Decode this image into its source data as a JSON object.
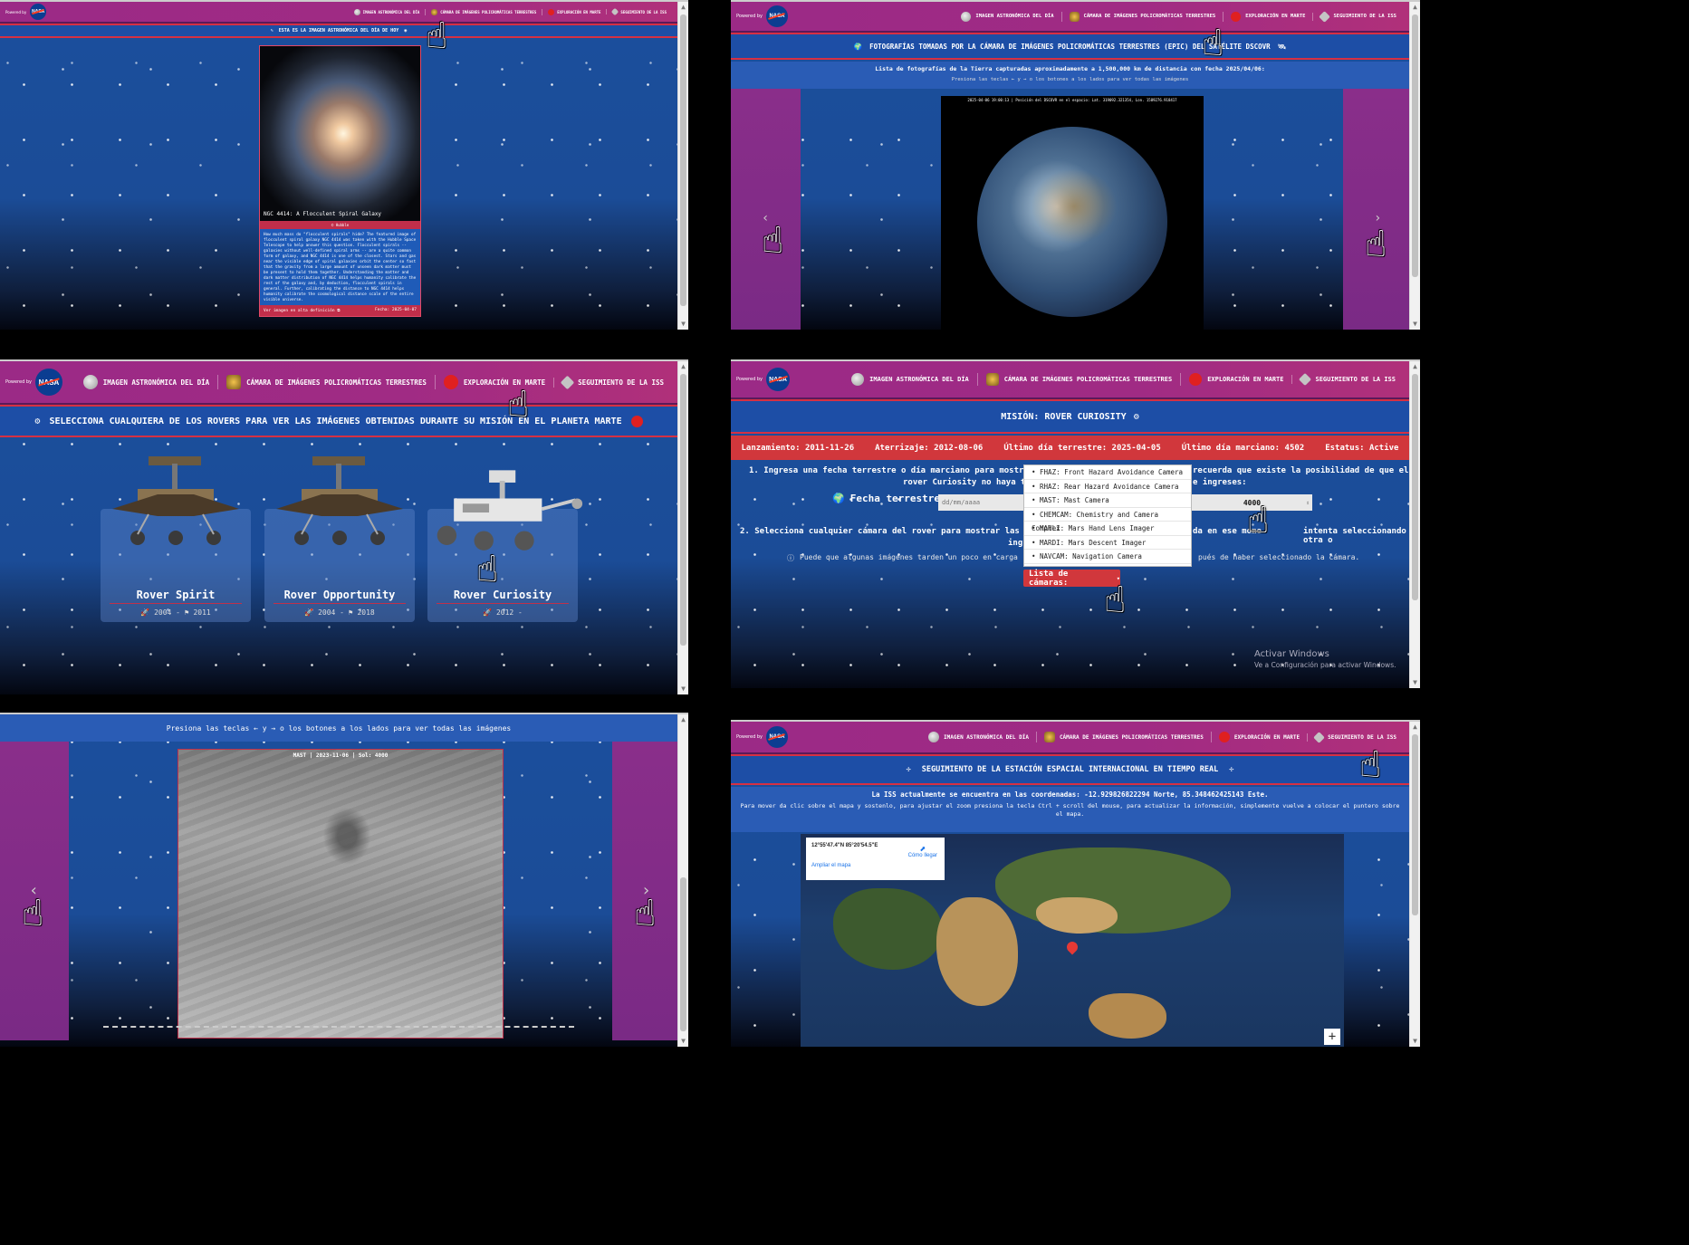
{
  "nav": {
    "powered_by": "Powered by",
    "logo": "NASA",
    "items": [
      "Imagen astronómica del día",
      "Cámara de imágenes policromáticas terrestres",
      "Exploración en Marte",
      "Seguimiento de la ISS"
    ]
  },
  "apod": {
    "banner": "Esta es la imagen astronómica del día de hoy",
    "image_title": "NGC 4414: A Flocculent Spiral Galaxy",
    "credit": "Hubble",
    "description": "How much mass do \"flocculent spirals\" hide? The featured image of flocculent spiral galaxy NGC 4414 was taken with the Hubble Space Telescope to help answer this question. Flocculent spirals -- galaxies without well-defined spiral arms -- are a quite common form of galaxy, and NGC 4414 is one of the closest. Stars and gas near the visible edge of spiral galaxies orbit the center so fast that the gravity from a large amount of unseen dark matter must be present to hold them together. Understanding the matter and dark matter distribution of NGC 4414 helps humanity calibrate the rest of the galaxy and, by deduction, flocculent spirals in general. Further, calibrating the distance to NGC 4414 helps humanity calibrate the cosmological distance scale of the entire visible universe.",
    "hd_link": "Ver imagen en alta definición",
    "date": "Fecha: 2025-04-07"
  },
  "epic": {
    "banner": "Fotografías tomadas por la cámara de imágenes policromáticas terrestres (EPIC) del satélite DSCOVR",
    "subtitle": "Lista de fotografías de la Tierra capturadas aproximadamente a 1,500,000 km de distancia con fecha 2025/04/06:",
    "hint": "Presiona las teclas ← y → o los botones a los lados para ver todas las imágenes",
    "caption": "2025-04-06 19:00:13 | Posición del DSCOVR en el espacio: Lat. 319092.321354, Lon. 1589276.918417"
  },
  "mars_select": {
    "banner": "Selecciona cualquiera de los rovers para ver las imágenes obtenidas durante su misión en el planeta Marte",
    "rovers": [
      {
        "name": "Rover Spirit",
        "start": "2004",
        "end": "2011"
      },
      {
        "name": "Rover Opportunity",
        "start": "2004",
        "end": "2018"
      },
      {
        "name": "Rover Curiosity",
        "start": "2012",
        "end": ""
      }
    ]
  },
  "mission": {
    "banner": "Misión: Rover Curiosity",
    "launch": "Lanzamiento: 2011-11-26",
    "landing": "Aterrizaje: 2012-08-06",
    "last_earth": "Último día terrestre: 2025-04-05",
    "last_sol": "Último día marciano: 4502",
    "status": "Estatus: Active",
    "step1_a": "1. Ingresa una fecha terrestre o día marciano para mostrar la",
    "step1_b": "recuerda que existe la posibilidad de que el",
    "step1_c": "rover Curiosity no haya tom",
    "step1_d": "e ingreses:",
    "earth_date_label": "Fecha terrestre:",
    "earth_date_placeholder": "dd/mm/aaaa",
    "sol_value": "4000",
    "step2_a": "2. Selecciona cualquier cámara del rover para mostrar las imág",
    "step2_b": "da en ese mome",
    "step2_c": "intenta seleccionando otra o",
    "step2_d": "ing",
    "note_a": "Puede que algunas imágenes tarden un poco en carga",
    "note_b": "pués de haber seleccionado la cámara.",
    "cameras": [
      "FHAZ: Front Hazard Avoidance Camera",
      "RHAZ: Rear Hazard Avoidance Camera",
      "MAST: Mast Camera",
      "CHEMCAM: Chemistry and Camera Complex",
      "MAHLI: Mars Hand Lens Imager",
      "MARDI: Mars Descent Imager",
      "NAVCAM: Navigation Camera"
    ],
    "camera_button": "Lista de cámaras:",
    "watermark_title": "Activar Windows",
    "watermark_sub": "Ve a Configuración para activar Windows."
  },
  "mars_photo": {
    "hint": "Presiona las teclas ← y → o los botones a los lados para ver todas las imágenes",
    "caption": "MAST | 2023-11-06 | Sol: 4000"
  },
  "iss": {
    "banner": "Seguimiento de la estación espacial internacional en tiempo real",
    "coords": "La ISS actualmente se encuentra en las coordenadas: -12.929826822294 Norte, 85.348462425143 Este.",
    "instructions": "Para mover da clic sobre el mapa y sostenlo, para ajustar el zoom presiona la tecla Ctrl + scroll del mouse, para actualizar la información, simplemente vuelve a colocar el puntero sobre el mapa.",
    "popup_coords": "12°55'47.4\"N 85°20'54.5\"E",
    "popup_directions": "Cómo llegar",
    "popup_link": "Ampliar el mapa",
    "zoom_in": "+"
  },
  "colors": {
    "nav": "#9b2a86",
    "banner": "#1d4ea6",
    "accent": "#d1373c"
  }
}
